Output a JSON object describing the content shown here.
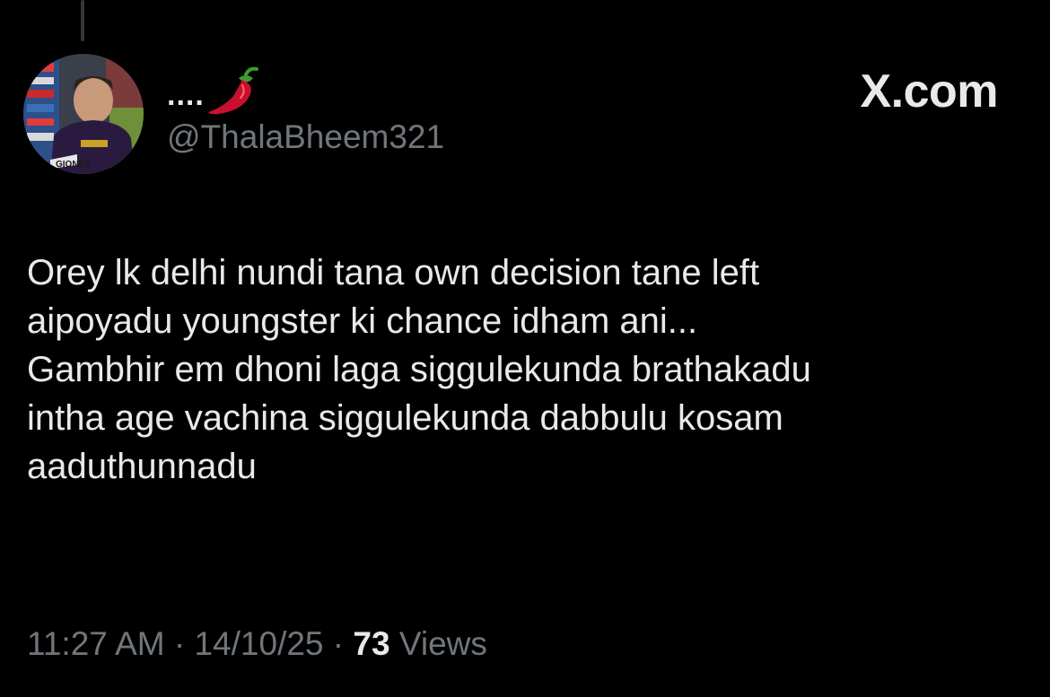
{
  "tweet": {
    "author": {
      "display_name": "....",
      "display_name_emoji": "chili-pepper-icon",
      "handle": "@ThalaBheem321"
    },
    "brand": "X.com",
    "text_lines": [
      "Orey lk delhi nundi tana own decision tane left",
      "aipoyadu youngster ki chance idham ani...",
      "Gambhir em dhoni laga siggulekunda brathakadu",
      "intha age vachina siggulekunda dabbulu kosam",
      "aaduthunnadu"
    ],
    "meta": {
      "time": "11:27 AM",
      "separator": "·",
      "date": "14/10/25",
      "views_count": "73",
      "views_label": "Views"
    },
    "avatar_text": "GIONEE"
  },
  "colors": {
    "background": "#000000",
    "primary_text": "#e7e9ea",
    "secondary_text": "#71767b",
    "thread_line": "#333639",
    "chili_red": "#c8102e",
    "chili_stem": "#3f9b2f"
  }
}
